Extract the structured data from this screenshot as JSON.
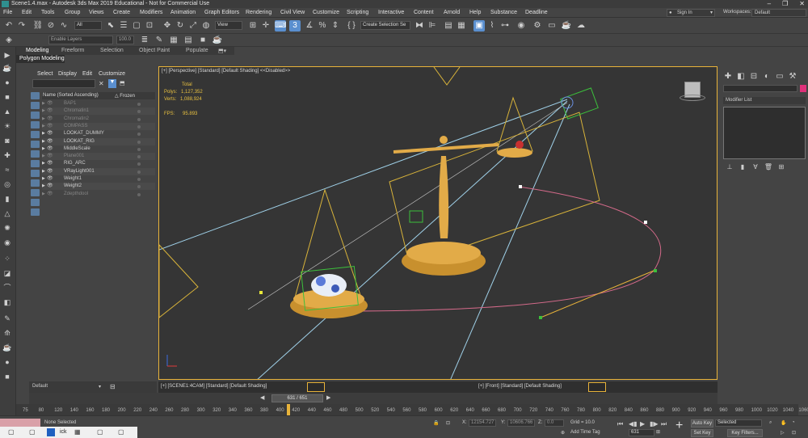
{
  "window": {
    "title": "Scene1.4.max - Autodesk 3ds Max 2019 Educational - Not for Commercial Use",
    "min": "–",
    "max": "❐",
    "close": "✕"
  },
  "menu": [
    "File",
    "Edit",
    "Tools",
    "Group",
    "Views",
    "Create",
    "Modifiers",
    "Animation",
    "Graph Editors",
    "Rendering",
    "Civil View",
    "Customize",
    "Scripting",
    "Interactive",
    "Content",
    "Arnold",
    "Help",
    "Substance",
    "Deadline"
  ],
  "signin": "Sign In",
  "workspaces": {
    "label": "Workspaces:",
    "value": "Default"
  },
  "toolbar": {
    "filter": "All",
    "view": "View",
    "num3": "3",
    "create_selection": "Create Selection Se",
    "enable_layers": "Enable Layers",
    "num_field": "100.0"
  },
  "ribbon": {
    "tabs": [
      "Modeling",
      "Freeform",
      "Selection",
      "Object Paint",
      "Populate"
    ],
    "active": "Modeling",
    "sub": "Polygon Modeling"
  },
  "scene_explorer": {
    "menu": [
      "Select",
      "Display",
      "Edit",
      "Customize"
    ],
    "col_name": "Name (Sorted Ascending)",
    "col_frozen": "△ Frozen",
    "rows": [
      {
        "name": "BAP1",
        "dim": true
      },
      {
        "name": "Chromatin1",
        "dim": true
      },
      {
        "name": "Chromatin2",
        "dim": true
      },
      {
        "name": "COMPASS",
        "dim": true
      },
      {
        "name": "LOOKAT_DUMMY",
        "dim": false
      },
      {
        "name": "LOOKAT_RIG",
        "dim": false
      },
      {
        "name": "MiddleScale",
        "dim": false
      },
      {
        "name": "Plane001",
        "dim": true
      },
      {
        "name": "RIG_ARC",
        "dim": false
      },
      {
        "name": "VRayLight001",
        "dim": false
      },
      {
        "name": "Weight1",
        "dim": false
      },
      {
        "name": "Weight2",
        "dim": false
      },
      {
        "name": "Zdepthdool",
        "dim": true
      }
    ]
  },
  "viewport": {
    "label": "[+] [Perspective] [Standard] [Default Shading]  <<Disabled>>",
    "stats": {
      "total": "Total",
      "polys_label": "Polys:",
      "polys": "1,127,352",
      "verts_label": "Verts:",
      "verts": "1,088,924",
      "fps_label": "FPS:",
      "fps": "95.893"
    }
  },
  "command_panel": {
    "modifier_list": "Modifier List"
  },
  "layer": {
    "value": "Default"
  },
  "bottom_views": {
    "left": "[+] [SCENE1:4CAM] [Standard] [Default Shading]",
    "right": "[+] [Front] [Standard] [Default Shading]"
  },
  "timeslider": {
    "value": "631 / 651"
  },
  "ruler": [
    "75",
    "80",
    "120",
    "140",
    "160",
    "180",
    "200",
    "220",
    "240",
    "260",
    "280",
    "300",
    "320",
    "340",
    "360",
    "380",
    "400",
    "420",
    "440",
    "460",
    "480",
    "500",
    "520",
    "540",
    "560",
    "580",
    "600",
    "620",
    "640",
    "660",
    "680",
    "700",
    "720",
    "740",
    "760",
    "780",
    "800",
    "820",
    "840",
    "860",
    "880",
    "900",
    "920",
    "940",
    "960",
    "980",
    "1000",
    "1020",
    "1040",
    "1060"
  ],
  "status": {
    "selection": "None Selected",
    "x_label": "X:",
    "x": "12154.727",
    "y_label": "Y:",
    "y": "10606.766",
    "z_label": "Z:",
    "z": "0.0",
    "grid": "Grid = 10.0",
    "add_time_tag": "Add Time Tag",
    "frame": "631",
    "auto_key": "Auto Key",
    "selected": "Selected",
    "set_key": "Set Key",
    "key_filters": "Key Filters..."
  },
  "taskbar_text": "ick"
}
